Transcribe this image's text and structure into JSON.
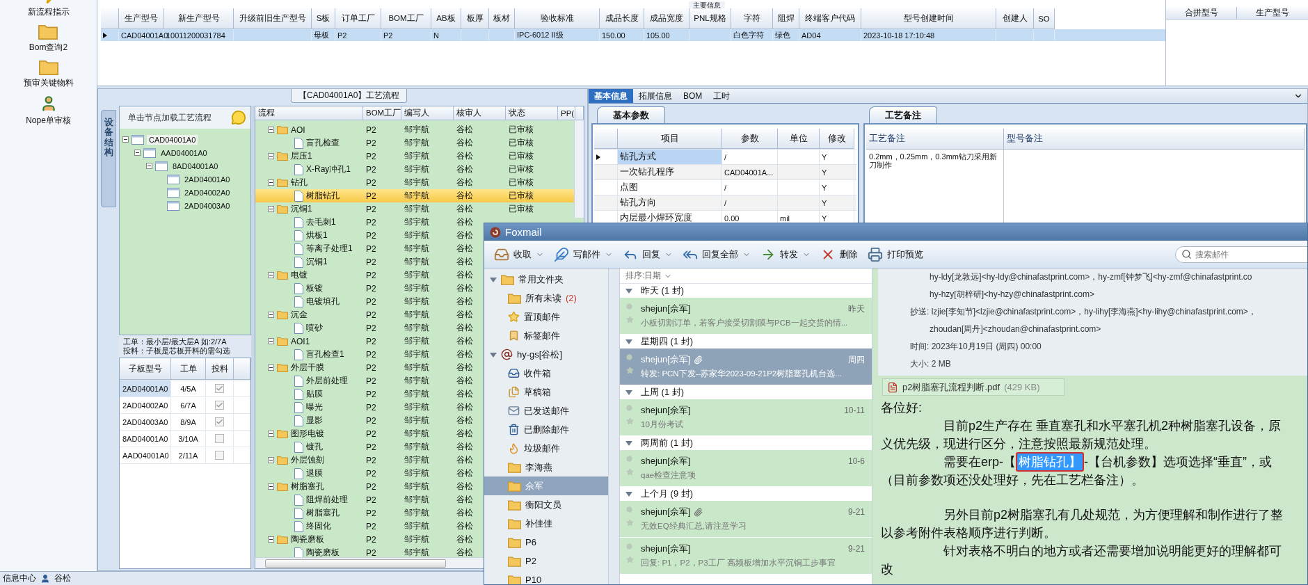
{
  "sidebar": {
    "items": [
      {
        "label": "新流程指示",
        "kind": "flash"
      },
      {
        "label": "Bom查询2",
        "kind": "folder"
      },
      {
        "label": "预审关键物料",
        "kind": "folder"
      },
      {
        "label": "Nope单审核",
        "kind": "user"
      }
    ]
  },
  "main_info": {
    "group_title": "主要信息",
    "columns": [
      "生产型号",
      "新生产型号",
      "升级前旧生产型号",
      "S板",
      "订单工厂",
      "BOM工厂",
      "AB板",
      "板厚",
      "板材",
      "验收标准",
      "成品长度",
      "成品宽度",
      "PNL规格",
      "字符",
      "阻焊",
      "终端客户代码",
      "型号创建时间",
      "创建人",
      "SO"
    ],
    "rows": [
      {
        "selected": true,
        "cells": [
          "CAD04001A0",
          "10011200031784",
          null,
          "母板",
          "P2",
          "P2",
          "N",
          null,
          null,
          "IPC-6012 II级",
          "150.00",
          "105.00",
          null,
          "白色字符",
          "绿色",
          "AD04",
          "2023-10-18 17:10:48",
          null,
          null
        ]
      }
    ]
  },
  "merge_grid": {
    "columns": [
      "合拼型号",
      "生产型号"
    ]
  },
  "process_panel": {
    "title": "【CAD04001A0】工艺流程",
    "side_tab": "设备结构",
    "tree_hint": "单击节点加载工艺流程",
    "tree": [
      {
        "label": "CAD04001A0",
        "expanded": true,
        "selected": true,
        "children": [
          {
            "label": "AAD04001A0",
            "expanded": true,
            "selected": false,
            "children": [
              {
                "label": "8AD04001A0",
                "expanded": true,
                "selected": false,
                "children": [
                  {
                    "label": "2AD04001A0",
                    "selected": false
                  },
                  {
                    "label": "2AD04002A0",
                    "selected": false
                  },
                  {
                    "label": "2AD04003A0",
                    "selected": false
                  }
                ]
              }
            ]
          }
        ]
      }
    ],
    "notes": [
      "工单：最小层/最大层A 如:2/7A",
      "投料：子板是芯板开料的需勾选"
    ],
    "sub_boards": {
      "columns": [
        "子板型号",
        "工单",
        "投料"
      ],
      "rows": [
        {
          "board": "2AD04001A0",
          "order": "4/5A",
          "checked": true,
          "selected": true
        },
        {
          "board": "2AD04002A0",
          "order": "6/7A",
          "checked": true,
          "selected": false
        },
        {
          "board": "2AD04003A0",
          "order": "8/9A",
          "checked": true,
          "selected": false
        },
        {
          "board": "8AD04001A0",
          "order": "3/10A",
          "checked": false,
          "selected": false
        },
        {
          "board": "AAD04001A0",
          "order": "2/11A",
          "checked": false,
          "selected": false
        }
      ]
    }
  },
  "process_grid": {
    "columns": [
      "流程",
      "BOM工厂",
      "编写人",
      "核审人",
      "状态",
      "PP("
    ],
    "rows": [
      {
        "name": "AOI",
        "kind": "folder",
        "expanded": true,
        "bom": "P2",
        "writer": "邹宇航",
        "reviewer": "谷松",
        "status": "已审核",
        "selected": false,
        "children": [
          {
            "name": "盲孔检查",
            "kind": "file",
            "bom": "P2",
            "writer": "邹宇航",
            "reviewer": "谷松",
            "status": "已审核",
            "selected": false
          }
        ]
      },
      {
        "name": "层压1",
        "kind": "folder",
        "expanded": true,
        "bom": "P2",
        "writer": "邹宇航",
        "reviewer": "谷松",
        "status": "已审核",
        "selected": false,
        "children": [
          {
            "name": "X-Ray冲孔1",
            "kind": "file",
            "bom": "P2",
            "writer": "邹宇航",
            "reviewer": "谷松",
            "status": "已审核",
            "selected": false
          }
        ]
      },
      {
        "name": "钻孔",
        "kind": "folder",
        "expanded": true,
        "bom": "P2",
        "writer": "邹宇航",
        "reviewer": "谷松",
        "status": "已审核",
        "selected": false,
        "children": [
          {
            "name": "树脂钻孔",
            "kind": "file",
            "bom": "P2",
            "writer": "邹宇航",
            "reviewer": "谷松",
            "status": "已审核",
            "selected": true
          }
        ]
      },
      {
        "name": "沉铜1",
        "kind": "folder",
        "expanded": true,
        "bom": "P2",
        "writer": "邹宇航",
        "reviewer": "谷松",
        "status": "已审核",
        "selected": false,
        "children": [
          {
            "name": "去毛刺1",
            "kind": "file",
            "bom": "P2",
            "writer": "邹宇航",
            "reviewer": "谷松",
            "selected": false
          },
          {
            "name": "烘板1",
            "kind": "file",
            "bom": "P2",
            "writer": "邹宇航",
            "reviewer": "谷松",
            "selected": false
          },
          {
            "name": "等离子处理1",
            "kind": "file",
            "bom": "P2",
            "writer": "邹宇航",
            "reviewer": "谷松",
            "selected": false
          },
          {
            "name": "沉铜1",
            "kind": "file",
            "bom": "P2",
            "writer": "邹宇航",
            "reviewer": "谷松",
            "selected": false
          }
        ]
      },
      {
        "name": "电镀",
        "kind": "folder",
        "expanded": true,
        "bom": "P2",
        "writer": "邹宇航",
        "reviewer": "谷松",
        "selected": false,
        "children": [
          {
            "name": "板镀",
            "kind": "file",
            "bom": "P2",
            "writer": "邹宇航",
            "reviewer": "谷松",
            "selected": false
          },
          {
            "name": "电镀填孔",
            "kind": "file",
            "bom": "P2",
            "writer": "邹宇航",
            "reviewer": "谷松",
            "selected": false
          }
        ]
      },
      {
        "name": "沉金",
        "kind": "folder",
        "expanded": true,
        "bom": "P2",
        "writer": "邹宇航",
        "reviewer": "谷松",
        "selected": false,
        "children": [
          {
            "name": "喷砂",
            "kind": "file",
            "bom": "P2",
            "writer": "邹宇航",
            "reviewer": "谷松",
            "selected": false
          }
        ]
      },
      {
        "name": "AOI1",
        "kind": "folder",
        "expanded": true,
        "bom": "P2",
        "writer": "邹宇航",
        "reviewer": "谷松",
        "selected": false,
        "children": [
          {
            "name": "盲孔检查1",
            "kind": "file",
            "bom": "P2",
            "writer": "邹宇航",
            "reviewer": "谷松",
            "selected": false
          }
        ]
      },
      {
        "name": "外层干膜",
        "kind": "folder",
        "expanded": true,
        "bom": "P2",
        "writer": "邹宇航",
        "reviewer": "谷松",
        "selected": false,
        "children": [
          {
            "name": "外层前处理",
            "kind": "file",
            "bom": "P2",
            "writer": "邹宇航",
            "reviewer": "谷松",
            "selected": false
          },
          {
            "name": "贴膜",
            "kind": "file",
            "bom": "P2",
            "writer": "邹宇航",
            "reviewer": "谷松",
            "selected": false
          },
          {
            "name": "曝光",
            "kind": "file",
            "bom": "P2",
            "writer": "邹宇航",
            "reviewer": "谷松",
            "selected": false
          },
          {
            "name": "显影",
            "kind": "file",
            "bom": "P2",
            "writer": "邹宇航",
            "reviewer": "谷松",
            "selected": false
          }
        ]
      },
      {
        "name": "图形电镀",
        "kind": "folder",
        "expanded": true,
        "bom": "P2",
        "writer": "邹宇航",
        "reviewer": "谷松",
        "selected": false,
        "children": [
          {
            "name": "镀孔",
            "kind": "file",
            "bom": "P2",
            "writer": "邹宇航",
            "reviewer": "谷松",
            "selected": false
          }
        ]
      },
      {
        "name": "外层蚀刻",
        "kind": "folder",
        "expanded": true,
        "bom": "P2",
        "writer": "邹宇航",
        "reviewer": "谷松",
        "selected": false,
        "children": [
          {
            "name": "退膜",
            "kind": "file",
            "bom": "P2",
            "writer": "邹宇航",
            "reviewer": "谷松",
            "selected": false
          }
        ]
      },
      {
        "name": "树脂塞孔",
        "kind": "folder",
        "expanded": true,
        "bom": "P2",
        "writer": "邹宇航",
        "reviewer": "谷松",
        "selected": false,
        "children": [
          {
            "name": "阻焊前处理",
            "kind": "file",
            "bom": "P2",
            "writer": "邹宇航",
            "reviewer": "谷松",
            "selected": false
          },
          {
            "name": "树脂塞孔",
            "kind": "file",
            "bom": "P2",
            "writer": "邹宇航",
            "reviewer": "谷松",
            "selected": false
          },
          {
            "name": "终固化",
            "kind": "file",
            "bom": "P2",
            "writer": "邹宇航",
            "reviewer": "谷松",
            "selected": false
          }
        ]
      },
      {
        "name": "陶瓷磨板",
        "kind": "folder",
        "expanded": true,
        "bom": "P2",
        "writer": "邹宇航",
        "reviewer": "谷松",
        "selected": false,
        "children": [
          {
            "name": "陶瓷磨板",
            "kind": "file",
            "bom": "P2",
            "writer": "邹宇航",
            "reviewer": "谷松",
            "selected": false
          }
        ]
      }
    ]
  },
  "detail_tabs": [
    {
      "label": "基本信息",
      "selected": true
    },
    {
      "label": "拓展信息",
      "selected": false
    },
    {
      "label": "BOM",
      "selected": false
    },
    {
      "label": "工时",
      "selected": false
    }
  ],
  "basic_params": {
    "title": "基本参数",
    "columns": [
      "项目",
      "参数",
      "单位",
      "修改"
    ],
    "rows": [
      {
        "item": "钻孔方式",
        "value": "/",
        "modify": "Y",
        "selected": true
      },
      {
        "item": "一次钻孔程序",
        "value": "CAD04001A...",
        "modify": "Y",
        "selected": false
      },
      {
        "item": "点图",
        "value": "/",
        "modify": "Y",
        "selected": false
      },
      {
        "item": "钻孔方向",
        "value": "/",
        "modify": "Y",
        "selected": false
      },
      {
        "item": "内层最小焊环宽度",
        "value": "0.00",
        "unit": "mil",
        "modify": "Y",
        "selected": false
      }
    ]
  },
  "process_notes": {
    "title": "工艺备注",
    "columns": [
      "工艺备注",
      "型号备注"
    ],
    "note": "0.2mm，0.25mm，0.3mm钻刀采用新刀制作"
  },
  "status_bar": {
    "items": [
      "信息中心",
      "谷松"
    ]
  },
  "foxmail": {
    "title": "Foxmail",
    "toolbar": [
      {
        "label": "收取",
        "kind": "receive",
        "dropdown": true
      },
      {
        "label": "写邮件",
        "kind": "compose",
        "dropdown": true
      },
      {
        "label": "回复",
        "kind": "reply",
        "dropdown": true
      },
      {
        "label": "回复全部",
        "kind": "replyall",
        "dropdown": true
      },
      {
        "label": "转发",
        "kind": "forward",
        "dropdown": true
      },
      {
        "label": "删除",
        "kind": "delete",
        "dropdown": false
      },
      {
        "label": "打印预览",
        "kind": "print",
        "dropdown": false
      }
    ],
    "search": {
      "placeholder": "搜索邮件"
    },
    "folders": [
      {
        "label": "常用文件夹",
        "kind": "group",
        "expanded": true,
        "selected": false,
        "children": [
          {
            "label": "所有未读",
            "count": "(2)",
            "kind": "folder",
            "selected": false
          },
          {
            "label": "置顶邮件",
            "kind": "star",
            "selected": false
          },
          {
            "label": "标签邮件",
            "kind": "tag",
            "selected": false
          }
        ]
      },
      {
        "label": "hy-gs[谷松]",
        "kind": "account",
        "expanded": true,
        "selected": false,
        "children": [
          {
            "label": "收件箱",
            "kind": "inbox",
            "selected": false
          },
          {
            "label": "草稿箱",
            "kind": "draft",
            "selected": false
          },
          {
            "label": "已发送邮件",
            "kind": "sent",
            "selected": false
          },
          {
            "label": "已删除邮件",
            "kind": "trash",
            "selected": false
          },
          {
            "label": "垃圾邮件",
            "kind": "spam",
            "selected": false
          },
          {
            "label": "李海燕",
            "kind": "folder",
            "selected": false
          },
          {
            "label": "佘军",
            "kind": "folder",
            "selected": true
          },
          {
            "label": "衡阳文员",
            "kind": "folder",
            "selected": false
          },
          {
            "label": "补佳佳",
            "kind": "folder",
            "selected": false
          },
          {
            "label": "P6",
            "kind": "folder",
            "selected": false
          },
          {
            "label": "P2",
            "kind": "folder",
            "selected": false
          },
          {
            "label": "P10",
            "kind": "folder",
            "selected": false
          }
        ]
      }
    ],
    "sort": "排序:日期",
    "message_groups": [
      {
        "label": "昨天 (1 封)",
        "expanded": true,
        "messages": [
          {
            "from": "shejun[佘军]",
            "date": "昨天",
            "subject": "小板切割订单，若客户接受切割膜与PCB一起交货的情...",
            "attachment": false,
            "selected": false
          }
        ]
      },
      {
        "label": "星期四 (1 封)",
        "expanded": true,
        "messages": [
          {
            "from": "shejun[佘军]",
            "date": "周四",
            "subject": "转发: PCN下发--苏家华2023-09-21P2树脂塞孔机台选...",
            "attachment": true,
            "selected": true
          }
        ]
      },
      {
        "label": "上周 (1 封)",
        "expanded": true,
        "messages": [
          {
            "from": "shejun[佘军]",
            "date": "10-11",
            "subject": "10月份考试",
            "attachment": false,
            "selected": false
          }
        ]
      },
      {
        "label": "两周前 (1 封)",
        "expanded": true,
        "messages": [
          {
            "from": "shejun[佘军]",
            "date": "10-6",
            "subject": "qae检查注意项",
            "attachment": false,
            "selected": false
          }
        ]
      },
      {
        "label": "上个月 (9 封)",
        "expanded": true,
        "messages": [
          {
            "from": "shejun[佘军]",
            "date": "9-21",
            "subject": "无效EQ经典汇总,请注意学习",
            "attachment": true,
            "selected": false
          },
          {
            "from": "shejun[佘军]",
            "date": "9-21",
            "subject": "回复: P1，P2，P3工厂 高频板增加水平沉铜工步事宜",
            "attachment": false,
            "selected": false
          }
        ]
      }
    ],
    "reading": {
      "header_lines": [
        {
          "text": "hy-ldy[龙敦远]<hy-ldy@chinafastprint.com>，hy-zmf[钟梦飞]<hy-zmf@chinafastprint.co",
          "kind": "continued"
        },
        {
          "text": "hy-hzy[胡梓研]<hy-hzy@chinafastprint.com>",
          "kind": "continued"
        },
        {
          "text": "抄送: lzjie[李知节]<lzjie@chinafastprint.com>，hy-lihy[李海燕]<hy-lihy@chinafastprint.com>，",
          "kind": "label"
        },
        {
          "text": "zhoudan[周丹]<zhoudan@chinafastprint.com>",
          "kind": "continued"
        },
        {
          "text": "时间: 2023年10月19日 (周四) 00:00",
          "kind": "label"
        },
        {
          "text": "大小: 2 MB",
          "kind": "label"
        }
      ],
      "attachment": {
        "name": "p2树脂塞孔流程判断.pdf",
        "size": "(429 KB)"
      },
      "body": [
        {
          "kind": "plain",
          "segments": [
            {
              "text": "各位好:",
              "selected": false
            }
          ]
        },
        {
          "kind": "indent",
          "segments": [
            {
              "text": "目前p2生产存在 垂直塞孔和水平塞孔机2种树脂塞孔设备，原",
              "selected": false
            }
          ]
        },
        {
          "kind": "plain",
          "segments": [
            {
              "text": "义优先级，现进行区分，注意按照最新规范处理。",
              "selected": false
            }
          ]
        },
        {
          "kind": "indent",
          "segments": [
            {
              "text": "需要在erp-【",
              "selected": false
            },
            {
              "text": "树脂钻孔】",
              "selected": true
            },
            {
              "text": "-【台机参数】选项选择“垂直”，或",
              "selected": false
            }
          ]
        },
        {
          "kind": "plain",
          "segments": [
            {
              "text": "（目前参数项还没处理好，先在工艺栏备注）。",
              "selected": false
            }
          ]
        },
        {
          "kind": "indent_gap",
          "segments": [
            {
              "text": "另外目前p2树脂塞孔有几处规范，为方便理解和制作进行了整",
              "selected": false
            }
          ]
        },
        {
          "kind": "plain",
          "segments": [
            {
              "text": "以参考附件表格顺序进行判断。",
              "selected": false
            }
          ]
        },
        {
          "kind": "indent",
          "segments": [
            {
              "text": "针对表格不明白的地方或者还需要增加说明能更好的理解都可",
              "selected": false
            }
          ]
        },
        {
          "kind": "plain",
          "segments": [
            {
              "text": "改",
              "selected": false
            }
          ]
        }
      ]
    }
  }
}
